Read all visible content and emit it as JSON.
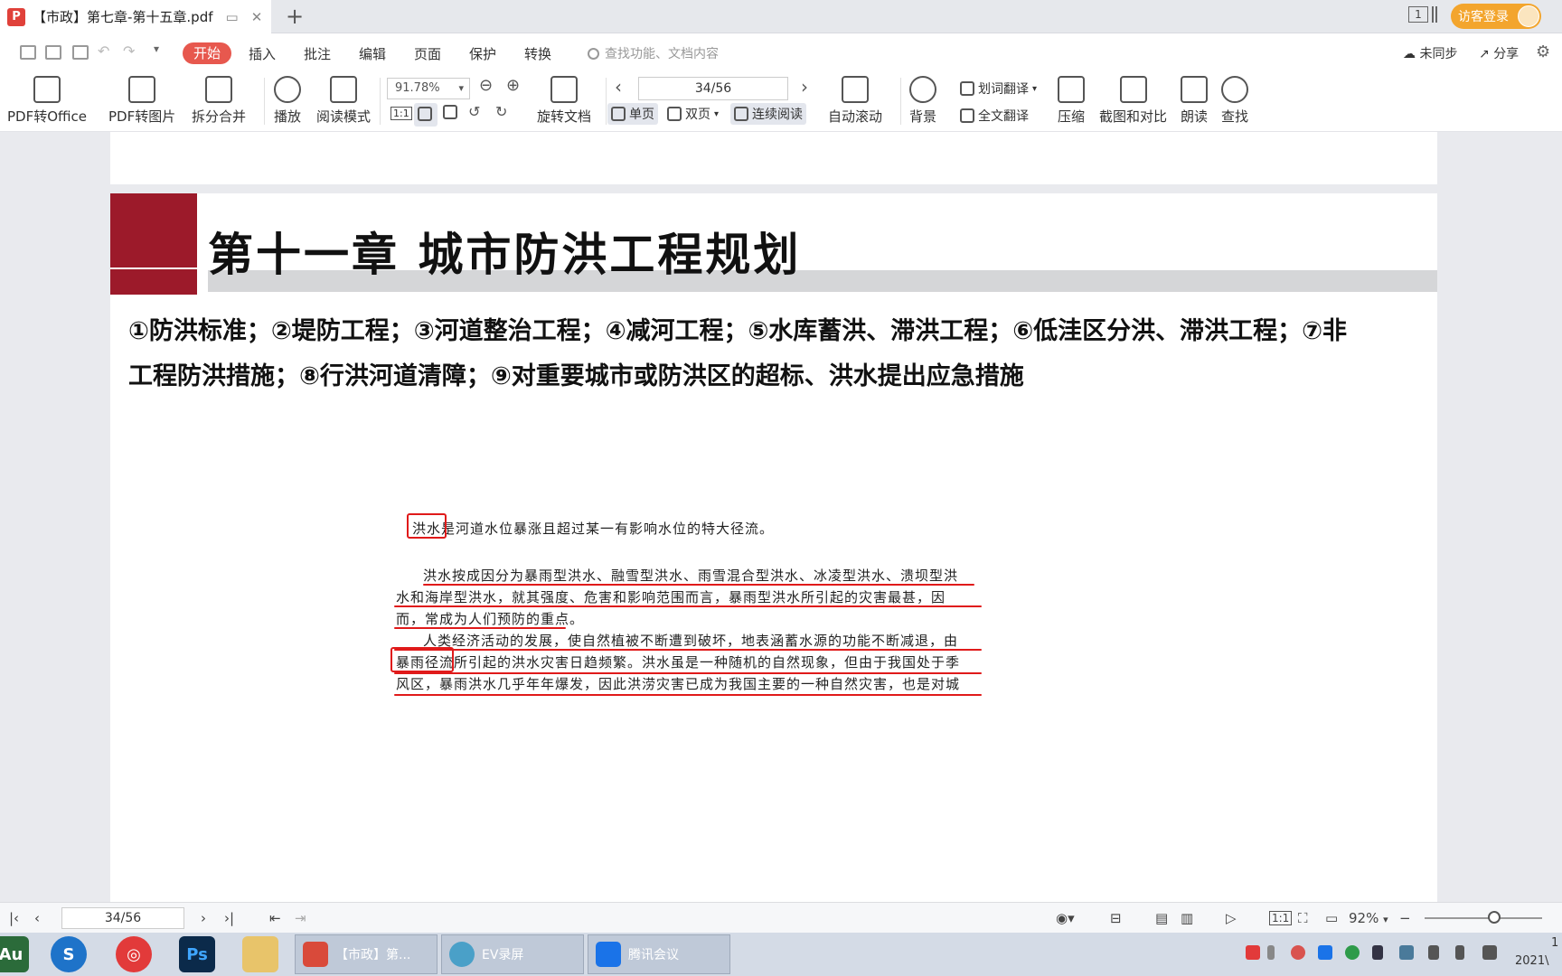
{
  "titlebar": {
    "tab_title": "【市政】第七章-第十五章.pdf",
    "window_count": "1",
    "guest_login": "访客登录"
  },
  "menubar": {
    "start": "开始",
    "items": [
      "插入",
      "批注",
      "编辑",
      "页面",
      "保护",
      "转换"
    ],
    "search_placeholder": "查找功能、文档内容",
    "sync": "未同步",
    "share": "分享"
  },
  "ribbon": {
    "pdf_to_office": "PDF转Office",
    "pdf_to_image": "PDF转图片",
    "split_merge": "拆分合并",
    "play": "播放",
    "read_mode": "阅读模式",
    "zoom": "91.78%",
    "rotate_doc": "旋转文档",
    "page_indicator": "34/56",
    "single_page": "单页",
    "double_page": "双页",
    "continuous": "连续阅读",
    "auto_scroll": "自动滚动",
    "background": "背景",
    "word_translate": "划词翻译",
    "full_translate": "全文翻译",
    "compress": "压缩",
    "screenshot_compare": "截图和对比",
    "read_aloud": "朗读",
    "find": "查找",
    "actual_size": "1:1"
  },
  "document": {
    "chapter_title": "第十一章 城市防洪工程规划",
    "summary_line1": "①防洪标准；②堤防工程；③河道整治工程；④减河工程；⑤水库蓄洪、滞洪工程；⑥低洼区分洪、滞洪工程；⑦非",
    "summary_line2": "工程防洪措施；⑧行洪河道清障；⑨对重要城市或防洪区的超标、洪水提出应急措施",
    "scan_lines": [
      "洪水是河道水位暴涨且超过某一有影响水位的特大径流。",
      "洪水按成因分为暴雨型洪水、融雪型洪水、雨雪混合型洪水、冰凌型洪水、溃坝型洪",
      "水和海岸型洪水，就其强度、危害和影响范围而言，暴雨型洪水所引起的灾害最甚，因",
      "而，常成为人们预防的重点。",
      "人类经济活动的发展，使自然植被不断遭到破坏，地表涵蓄水源的功能不断减退，由",
      "暴雨径流所引起的洪水灾害日趋频繁。洪水虽是一种随机的自然现象，但由于我国处于季",
      "风区，暴雨洪水几乎年年爆发，因此洪涝灾害已成为我国主要的一种自然灾害，也是对城"
    ]
  },
  "statusbar": {
    "page": "34/56",
    "zoom": "92%",
    "actual_size": "1:1"
  },
  "taskbar": {
    "apps": [
      "Au",
      "Ps"
    ],
    "windows": [
      "【市政】第...",
      "EV录屏",
      "腾讯会议"
    ],
    "clock_line1": "1",
    "clock_line2": "2021\\"
  },
  "colors": {
    "accent_red": "#e7584e",
    "chapter_red": "#9c1a2a",
    "guest_orange": "#f3a52d",
    "annotation_red": "#e01a1a"
  }
}
